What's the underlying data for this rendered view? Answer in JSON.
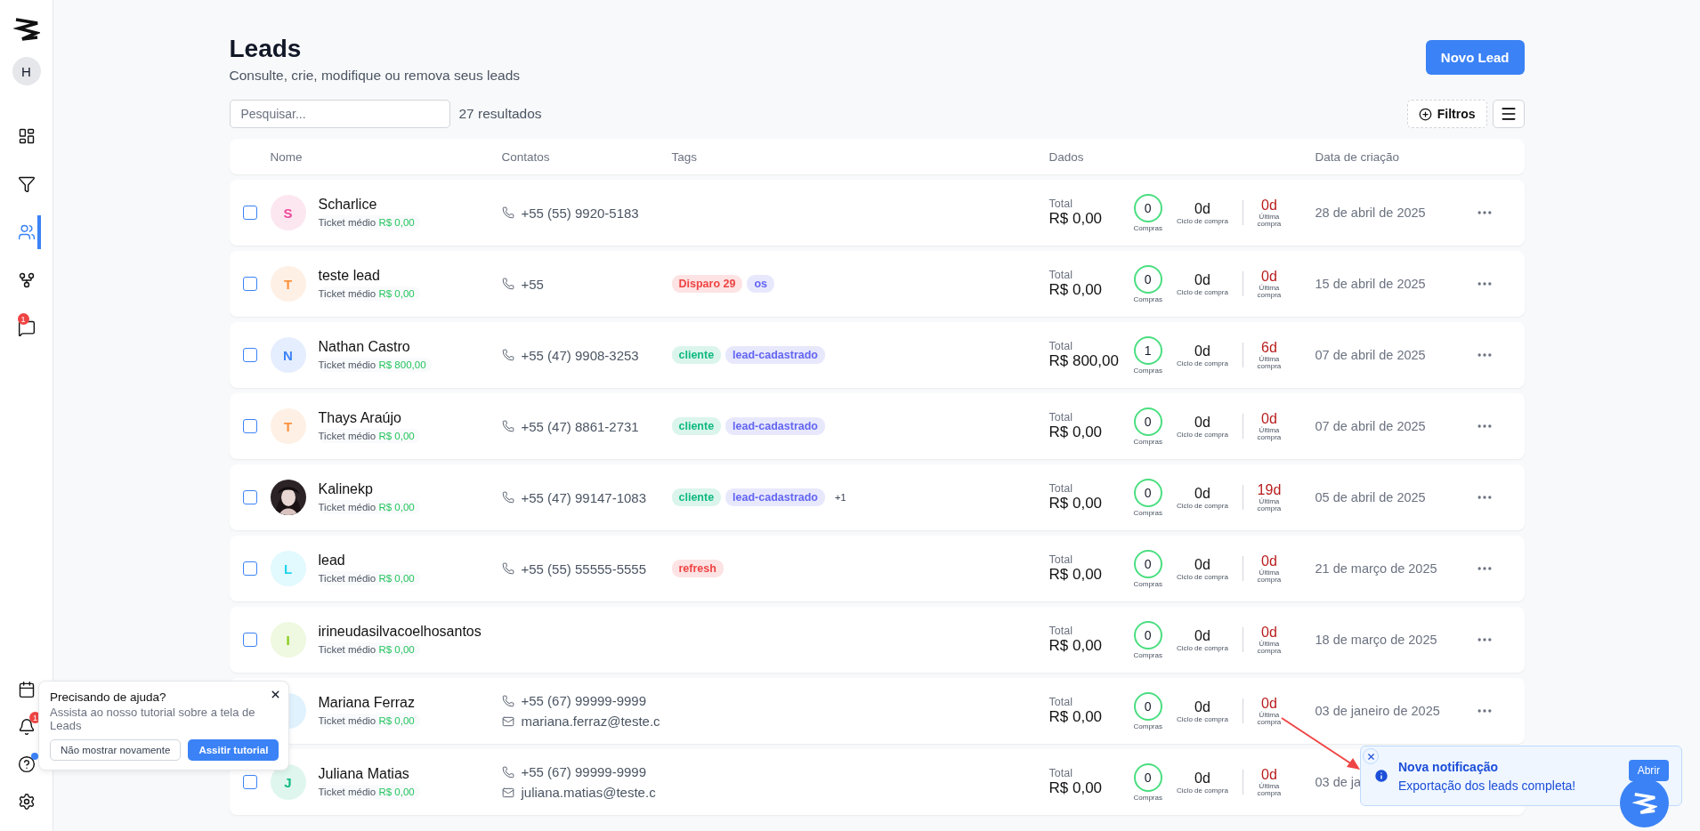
{
  "sidebar": {
    "avatar": "H",
    "nav": [
      {
        "kind": "dashboard",
        "selected": false
      },
      {
        "kind": "funnel",
        "selected": false
      },
      {
        "kind": "users",
        "selected": true
      },
      {
        "kind": "fork",
        "selected": false
      },
      {
        "kind": "chat",
        "selected": false,
        "badge": "1"
      }
    ],
    "bottom": [
      {
        "kind": "calendar"
      },
      {
        "kind": "bell",
        "badge": "1"
      },
      {
        "kind": "help",
        "dot": true
      },
      {
        "kind": "settings"
      }
    ]
  },
  "header": {
    "title": "Leads",
    "subtitle": "Consulte, crie, modifique ou remova seus leads",
    "new_button": "Novo Lead"
  },
  "toolbar": {
    "search_placeholder": "Pesquisar...",
    "result_count": "27 resultados",
    "filter_button": "Filtros"
  },
  "table": {
    "columns": [
      "Nome",
      "Contatos",
      "Tags",
      "Dados",
      "Data de criação"
    ],
    "rows": [
      {
        "checked": false,
        "avatar": {
          "kind": "initial",
          "initial": "S",
          "color": "#ec4899"
        },
        "name": "Scharlice",
        "ticket_label": "Ticket médio",
        "ticket_value": "R$ 0,00",
        "contacts": [
          {
            "kind": "phone",
            "text": "+55 (55) 9920-5183"
          }
        ],
        "tags": [],
        "total_label": "Total",
        "total": "R$ 0,00",
        "purchases": "0",
        "purchases_label": "Compras",
        "cycle": "0d",
        "cycle_label": "Ciclo de compra",
        "last": "0d",
        "last_label": "Última compra",
        "date": "28 de abril de 2025",
        "more_options": true
      },
      {
        "checked": false,
        "avatar": {
          "kind": "initial",
          "initial": "T",
          "color": "#fb923c"
        },
        "name": "teste lead",
        "ticket_label": "Ticket médio",
        "ticket_value": "R$ 0,00",
        "contacts": [
          {
            "kind": "phone",
            "text": "+55"
          }
        ],
        "tags": [
          {
            "label": "Disparo 29",
            "color": "#ef4444"
          },
          {
            "label": "os",
            "color": "#6366f1"
          }
        ],
        "total_label": "Total",
        "total": "R$ 0,00",
        "purchases": "0",
        "purchases_label": "Compras",
        "cycle": "0d",
        "cycle_label": "Ciclo de compra",
        "last": "0d",
        "last_label": "Última compra",
        "date": "15 de abril de 2025",
        "more_options": true
      },
      {
        "checked": false,
        "avatar": {
          "kind": "initial",
          "initial": "N",
          "color": "#3b82f6"
        },
        "name": "Nathan Castro",
        "ticket_label": "Ticket médio",
        "ticket_value": "R$ 800,00",
        "contacts": [
          {
            "kind": "phone",
            "text": "+55 (47) 9908-3253"
          }
        ],
        "tags": [
          {
            "label": "cliente",
            "color": "#10b981"
          },
          {
            "label": "lead-cadastrado",
            "color": "#6366f1"
          }
        ],
        "total_label": "Total",
        "total": "R$ 800,00",
        "purchases": "1",
        "purchases_label": "Compras",
        "cycle": "0d",
        "cycle_label": "Ciclo de compra",
        "last": "6d",
        "last_label": "Última compra",
        "date": "07 de abril de 2025",
        "more_options": true
      },
      {
        "checked": false,
        "avatar": {
          "kind": "initial",
          "initial": "T",
          "color": "#fb923c"
        },
        "name": "Thays Araújo",
        "ticket_label": "Ticket médio",
        "ticket_value": "R$ 0,00",
        "contacts": [
          {
            "kind": "phone",
            "text": "+55 (47) 8861-2731"
          }
        ],
        "tags": [
          {
            "label": "cliente",
            "color": "#10b981"
          },
          {
            "label": "lead-cadastrado",
            "color": "#6366f1"
          }
        ],
        "total_label": "Total",
        "total": "R$ 0,00",
        "purchases": "0",
        "purchases_label": "Compras",
        "cycle": "0d",
        "cycle_label": "Ciclo de compra",
        "last": "0d",
        "last_label": "Última compra",
        "date": "07 de abril de 2025",
        "more_options": true
      },
      {
        "checked": false,
        "avatar": {
          "kind": "picture"
        },
        "name": "Kalinekp",
        "ticket_label": "Ticket médio",
        "ticket_value": "R$ 0,00",
        "contacts": [
          {
            "kind": "phone",
            "text": "+55 (47) 99147-1083"
          }
        ],
        "tags": [
          {
            "label": "cliente",
            "color": "#10b981"
          },
          {
            "label": "lead-cadastrado",
            "color": "#6366f1"
          }
        ],
        "more_tags": "+1",
        "total_label": "Total",
        "total": "R$ 0,00",
        "purchases": "0",
        "purchases_label": "Compras",
        "cycle": "0d",
        "cycle_label": "Ciclo de compra",
        "last": "19d",
        "last_label": "Última compra",
        "date": "05 de abril de 2025",
        "more_options": true
      },
      {
        "checked": false,
        "avatar": {
          "kind": "initial",
          "initial": "L",
          "color": "#22d3ee"
        },
        "name": "lead",
        "ticket_label": "Ticket médio",
        "ticket_value": "R$ 0,00",
        "contacts": [
          {
            "kind": "phone",
            "text": "+55 (55) 55555-5555"
          }
        ],
        "tags": [
          {
            "label": "refresh",
            "color": "#ef4444"
          }
        ],
        "total_label": "Total",
        "total": "R$ 0,00",
        "purchases": "0",
        "purchases_label": "Compras",
        "cycle": "0d",
        "cycle_label": "Ciclo de compra",
        "last": "0d",
        "last_label": "Última compra",
        "date": "21 de março de 2025",
        "more_options": true
      },
      {
        "checked": false,
        "avatar": {
          "kind": "initial",
          "initial": "I",
          "color": "#84cc16"
        },
        "name": "irineudasilvacoelhosantos",
        "ticket_label": "Ticket médio",
        "ticket_value": "R$ 0,00",
        "contacts": [],
        "tags": [],
        "total_label": "Total",
        "total": "R$ 0,00",
        "purchases": "0",
        "purchases_label": "Compras",
        "cycle": "0d",
        "cycle_label": "Ciclo de compra",
        "last": "0d",
        "last_label": "Última compra",
        "date": "18 de março de 2025",
        "more_options": true
      },
      {
        "avatar": {
          "kind": "initial"
        },
        "name": "Mariana Ferraz",
        "ticket_label": "Ticket médio",
        "ticket_value": "R$ 0,00",
        "contacts": [
          {
            "kind": "phone",
            "text": "+55 (67) 99999-9999"
          },
          {
            "kind": "email",
            "text": "mariana.ferraz@teste.c"
          }
        ],
        "tags": [],
        "total_label": "Total",
        "total": "R$ 0,00",
        "purchases": "0",
        "purchases_label": "Compras",
        "cycle": "0d",
        "cycle_label": "Ciclo de compra",
        "last": "0d",
        "last_label": "Última compra",
        "date": "03 de janeiro de 2025",
        "more_options": true
      },
      {
        "checked": false,
        "avatar": {
          "kind": "initial",
          "initial": "J",
          "color": "#10b981"
        },
        "name": "Juliana Matias",
        "ticket_label": "Ticket médio",
        "ticket_value": "R$ 0,00",
        "contacts": [
          {
            "kind": "phone",
            "text": "+55 (67) 99999-9999"
          },
          {
            "kind": "email",
            "text": "juliana.matias@teste.c"
          }
        ],
        "tags": [],
        "total_label": "Total",
        "total": "R$ 0,00",
        "purchases": "0",
        "purchases_label": "Compras",
        "cycle": "0d",
        "cycle_label": "Ciclo de compra",
        "last": "0d",
        "last_label": "Última compra",
        "date": "03 de ja"
      }
    ]
  },
  "help_popup": {
    "title": "Precisando de ajuda?",
    "body": "Assista ao nosso tutorial sobre a tela de Leads",
    "dismiss_button": "Não mostrar novamente",
    "watch_button": "Assitir tutorial"
  },
  "notification": {
    "title": "Nova notificação",
    "message": "Exportação dos leads completa!",
    "open_button": "Abrir"
  }
}
